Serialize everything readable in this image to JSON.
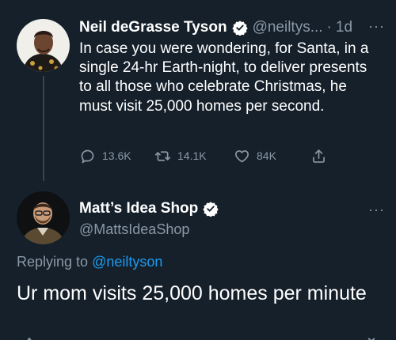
{
  "tweet": {
    "author_name": "Neil deGrasse Tyson",
    "author_handle": "@neiltys...",
    "dot": "·",
    "time": "1d",
    "more": "···",
    "text": "In case you were wondering, for Santa, in a single 24-hr Earth-night, to deliver presents to all those who celebrate Christmas, he must visit 25,000 homes per second.",
    "stats": {
      "replies": "13.6K",
      "retweets": "14.1K",
      "likes": "84K"
    },
    "icons": {
      "reply": "reply-icon",
      "retweet": "retweet-icon",
      "like": "heart-icon",
      "share": "share-icon"
    }
  },
  "reply": {
    "author_name": "Matt’s Idea Shop",
    "author_handle": "@MattsIdeaShop",
    "more": "···",
    "replying_prefix": "Replying to ",
    "replying_to": "@neiltyson",
    "text": "Ur mom visits 25,000 homes per minute"
  },
  "colors": {
    "background": "#15202b",
    "text": "#ffffff",
    "secondary": "#8b98a5",
    "accent": "#1d9bf0",
    "verified": "#ffffff"
  }
}
